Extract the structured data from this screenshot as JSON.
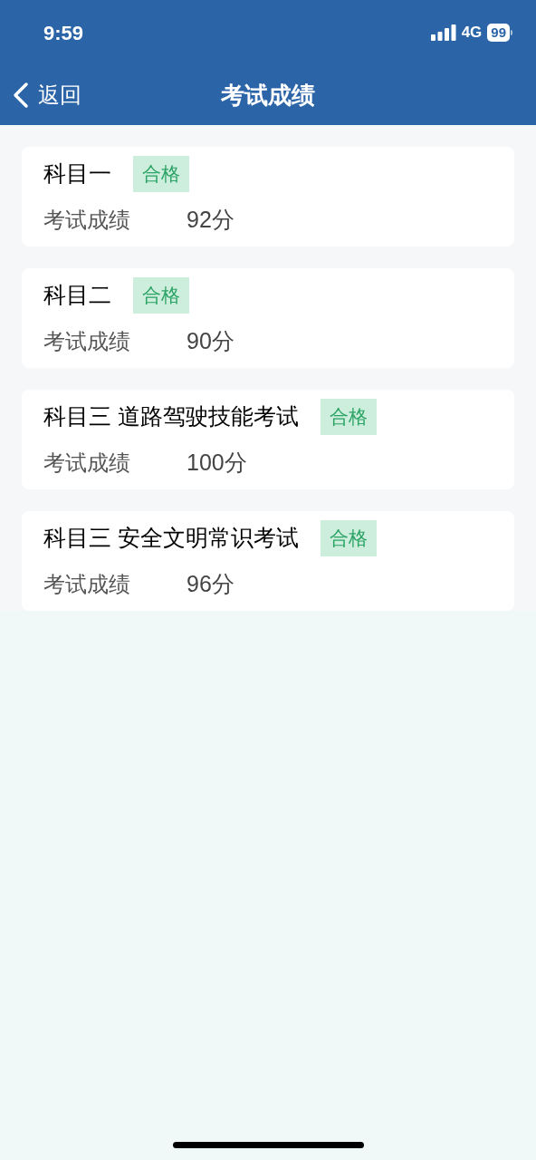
{
  "status_bar": {
    "time": "9:59",
    "network": "4G",
    "battery": "99"
  },
  "nav": {
    "back": "返回",
    "title": "考试成绩"
  },
  "results": [
    {
      "subject": "科目一",
      "badge": "合格",
      "label": "考试成绩",
      "score": "92分"
    },
    {
      "subject": "科目二",
      "badge": "合格",
      "label": "考试成绩",
      "score": "90分"
    },
    {
      "subject": "科目三 道路驾驶技能考试",
      "badge": "合格",
      "label": "考试成绩",
      "score": "100分"
    },
    {
      "subject": "科目三 安全文明常识考试",
      "badge": "合格",
      "label": "考试成绩",
      "score": "96分"
    }
  ]
}
